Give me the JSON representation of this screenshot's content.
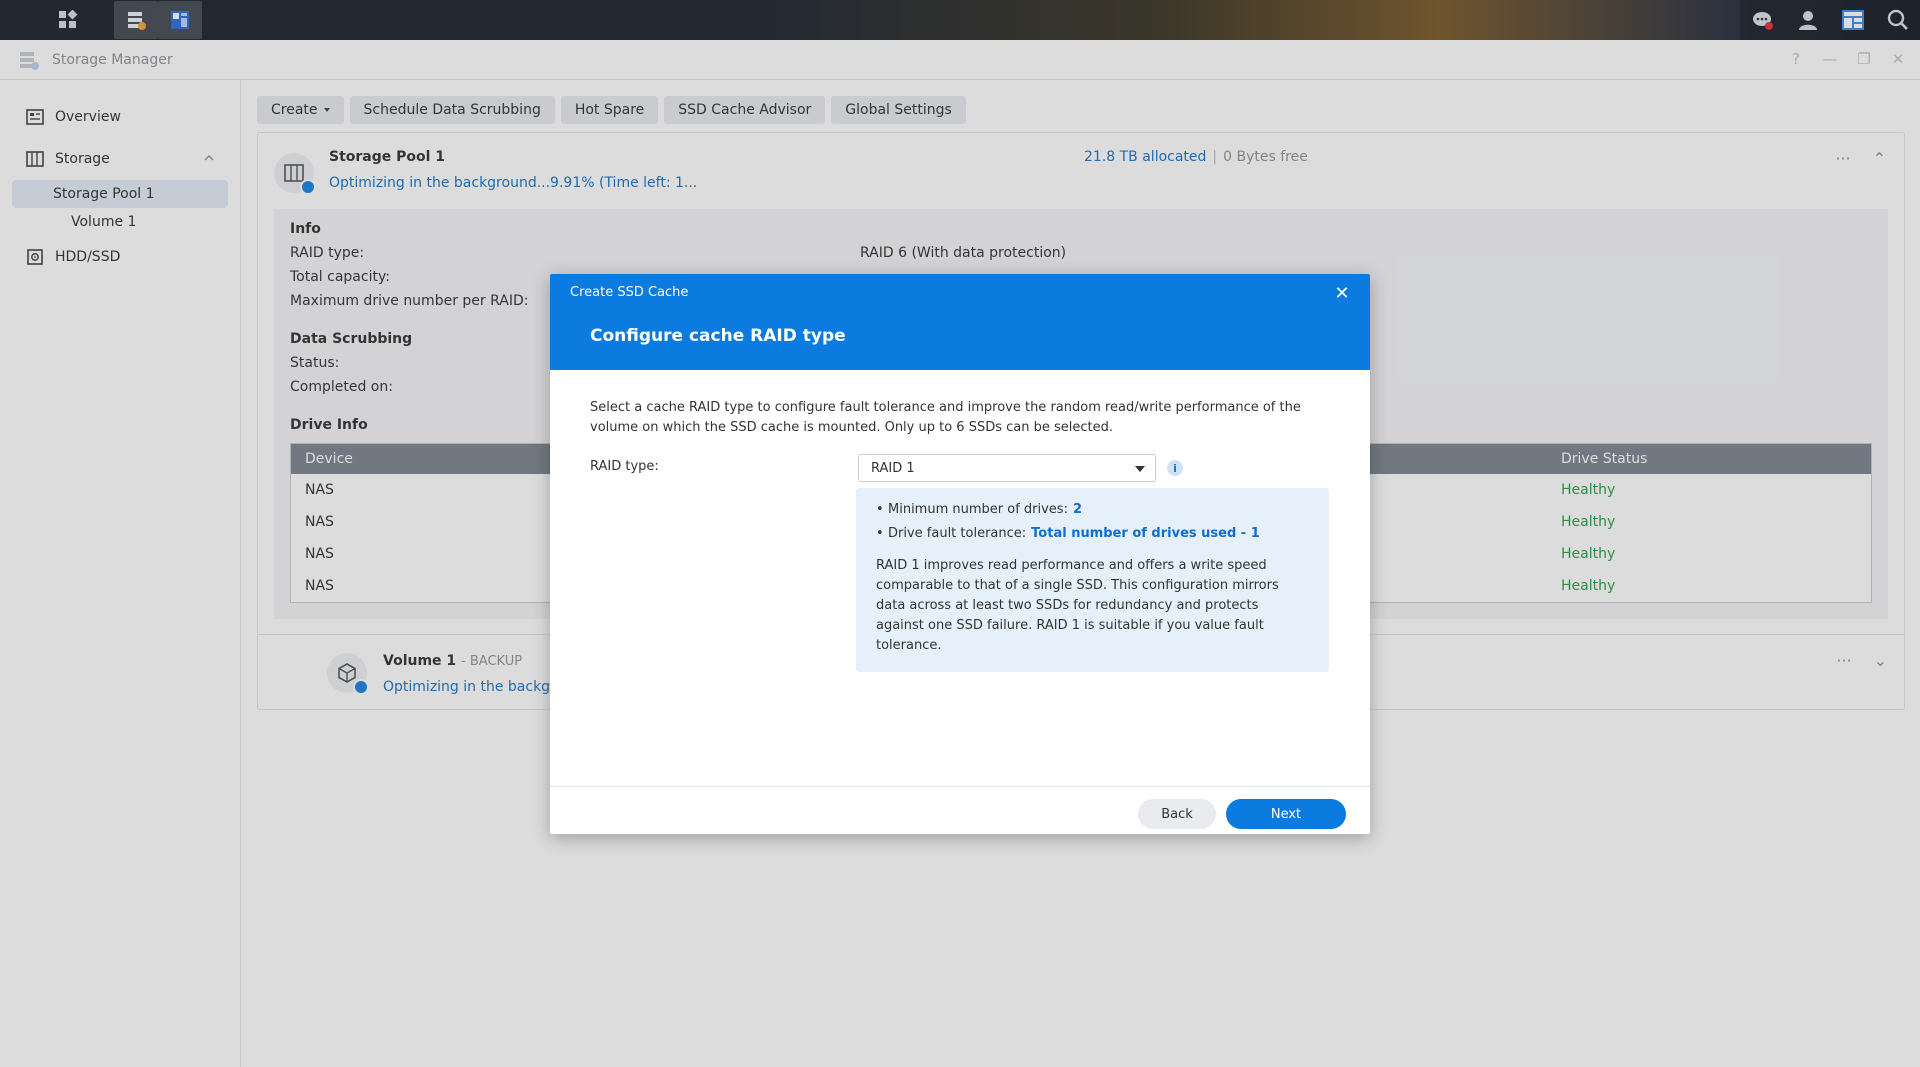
{
  "taskbar": {
    "left_icons": [
      "apps-grid-icon",
      "storage-manager-icon",
      "widget-icon"
    ],
    "right_icons": [
      "notification-icon",
      "user-icon",
      "widgets-panel-icon",
      "search-icon"
    ]
  },
  "window": {
    "title": "Storage Manager",
    "controls": {
      "help": "?",
      "minimize": "—",
      "restore": "❐",
      "close": "✕"
    }
  },
  "sidebar": {
    "overview": "Overview",
    "storage": "Storage",
    "storage_pool": "Storage Pool 1",
    "volume": "Volume 1",
    "hdd": "HDD/SSD"
  },
  "toolbar": {
    "create": "Create",
    "scrubbing": "Schedule Data Scrubbing",
    "hot_spare": "Hot Spare",
    "ssd_advisor": "SSD Cache Advisor",
    "global": "Global Settings"
  },
  "pool": {
    "title": "Storage Pool 1",
    "status": "Optimizing in the background...9.91% (Time left: 1...",
    "allocated": "21.8 TB allocated",
    "separator": "|",
    "free": "0 Bytes free",
    "more": "···",
    "collapse": "⌃",
    "info_title": "Info",
    "raid_label": "RAID type:",
    "raid_value": "RAID 6 (With data protection)",
    "capacity_label": "Total capacity:",
    "max_label": "Maximum drive number per RAID:",
    "scrub_title": "Data Scrubbing",
    "scrub_status": "Status:",
    "scrub_completed": "Completed on:",
    "drive_title": "Drive Info",
    "table": {
      "col_device": "Device",
      "col_status": "Drive Status",
      "rows": [
        {
          "device": "NAS",
          "status": "Healthy"
        },
        {
          "device": "NAS",
          "status": "Healthy"
        },
        {
          "device": "NAS",
          "status": "Healthy"
        },
        {
          "device": "NAS",
          "status": "Healthy"
        }
      ]
    }
  },
  "volume": {
    "title": "Volume 1",
    "subtitle": "- BACKUP",
    "status": "Optimizing in the backgro",
    "more": "···",
    "expand": "⌄"
  },
  "modal": {
    "small_title": "Create SSD Cache",
    "title": "Configure cache RAID type",
    "close": "✕",
    "description": "Select a cache RAID type to configure fault tolerance and improve the random read/write performance of the volume on which the SSD cache is mounted. Only up to 6 SSDs can be selected.",
    "raid_label": "RAID type:",
    "raid_selected": "RAID 1",
    "info_glyph": "i",
    "min_drives_label": "Minimum number of drives:",
    "min_drives_value": "2",
    "fault_label": "Drive fault tolerance:",
    "fault_value": "Total number of drives used - 1",
    "info_text": "RAID 1 improves read performance and offers a write speed comparable to that of a single SSD. This configuration mirrors data across at least two SSDs for redundancy and protects against one SSD failure. RAID 1 is suitable if you value fault tolerance.",
    "back": "Back",
    "next": "Next"
  },
  "colors": {
    "accent": "#0c7be0",
    "link": "#1a75c9",
    "healthy": "#27a04a",
    "table_header": "#7d8590"
  }
}
